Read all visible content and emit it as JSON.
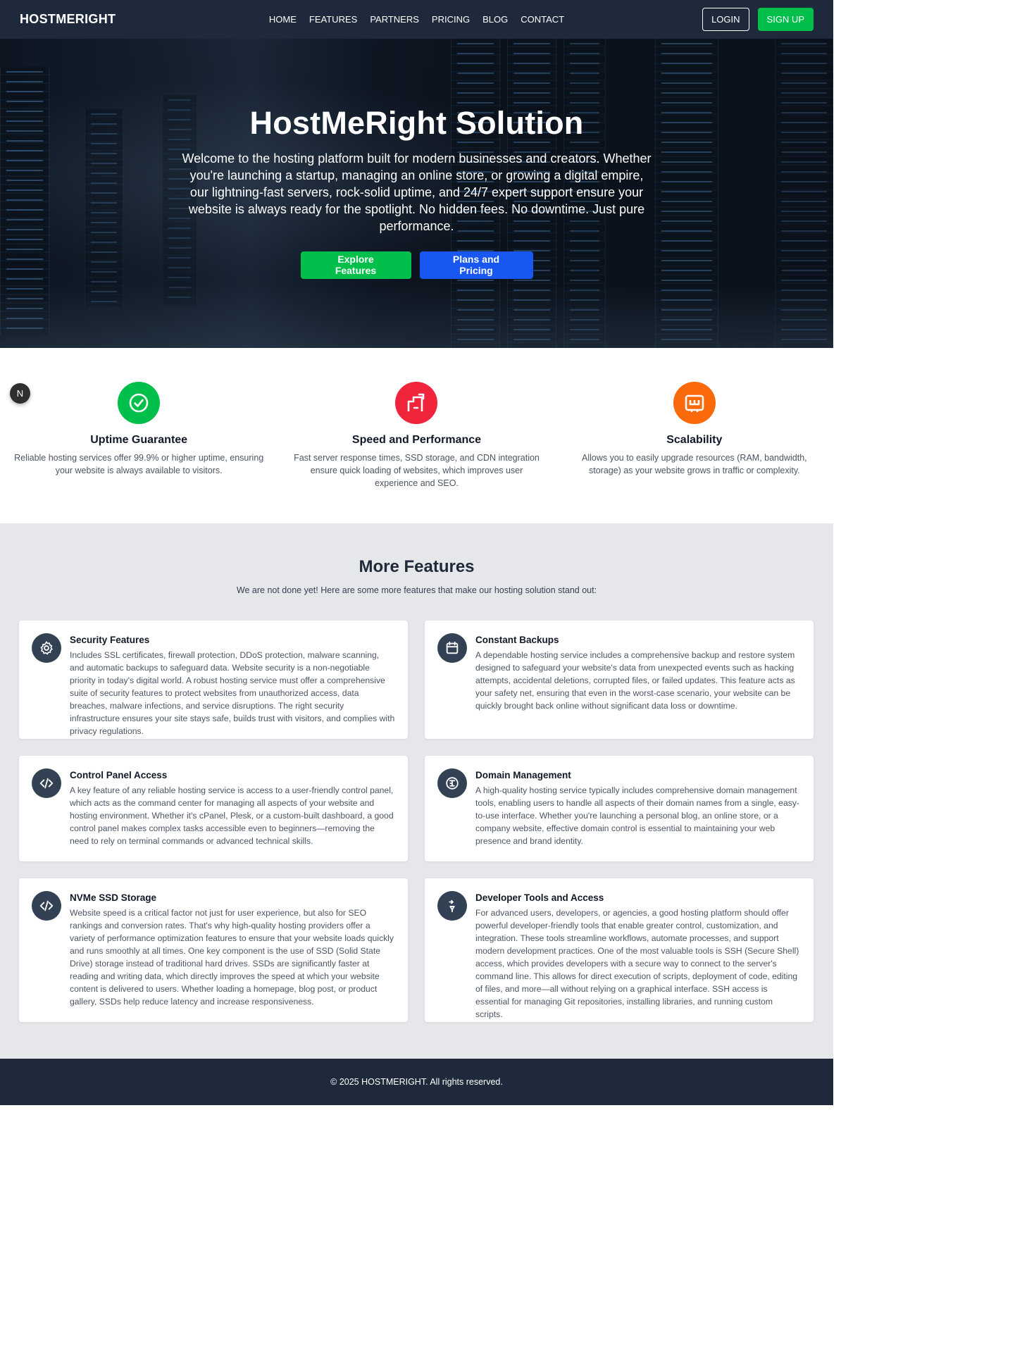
{
  "navbar": {
    "brand": "HOSTMERIGHT",
    "links": [
      "HOME",
      "FEATURES",
      "PARTNERS",
      "PRICING",
      "BLOG",
      "CONTACT"
    ],
    "login_label": "LOGIN",
    "signup_label": "SIGN UP"
  },
  "hero": {
    "title": "HostMeRight Solution",
    "text": "Welcome to the hosting platform built for modern businesses and creators. Whether you're launching a startup, managing an online store, or growing a digital empire, our lightning-fast servers, rock-solid uptime, and 24/7 expert support ensure your website is always ready for the spotlight. No hidden fees. No downtime. Just pure performance.",
    "explore_label": "Explore Features",
    "plans_label": "Plans and Pricing"
  },
  "floating_badge": "N",
  "highlights": [
    {
      "title": "Uptime Guarantee",
      "desc": "Reliable hosting services offer 99.9% or higher uptime, ensuring your website is always available to visitors.",
      "icon": "check-circle-icon",
      "color": "#00c04b"
    },
    {
      "title": "Speed and Performance",
      "desc": "Fast server response times, SSD storage, and CDN integration ensure quick loading of websites, which improves user experience and SEO.",
      "icon": "speed-icon",
      "color": "#f0243a"
    },
    {
      "title": "Scalability",
      "desc": "Allows you to easily upgrade resources (RAM, bandwidth, storage) as your website grows in traffic or complexity.",
      "icon": "scale-icon",
      "color": "#fa6a0a"
    }
  ],
  "more_features": {
    "title": "More Features",
    "subtitle": "We are not done yet! Here are some more features that make our hosting solution stand out:",
    "cards": [
      {
        "title": "Security Features",
        "icon": "gear-icon",
        "desc": "Includes SSL certificates, firewall protection, DDoS protection, malware scanning, and automatic backups to safeguard data. Website security is a non-negotiable priority in today's digital world. A robust hosting service must offer a comprehensive suite of security features to protect websites from unauthorized access, data breaches, malware infections, and service disruptions. The right security infrastructure ensures your site stays safe, builds trust with visitors, and complies with privacy regulations."
      },
      {
        "title": "Constant Backups",
        "icon": "calendar-icon",
        "desc": "A dependable hosting service includes a comprehensive backup and restore system designed to safeguard your website's data from unexpected events such as hacking attempts, accidental deletions, corrupted files, or failed updates. This feature acts as your safety net, ensuring that even in the worst-case scenario, your website can be quickly brought back online without significant data loss or downtime."
      },
      {
        "title": "Control Panel Access",
        "icon": "code-icon",
        "desc": "A key feature of any reliable hosting service is access to a user-friendly control panel, which acts as the command center for managing all aspects of your website and hosting environment. Whether it's cPanel, Plesk, or a custom-built dashboard, a good control panel makes complex tasks accessible even to beginners—removing the need to rely on terminal commands or advanced technical skills."
      },
      {
        "title": "Domain Management",
        "icon": "domain-icon",
        "desc": "A high-quality hosting service typically includes comprehensive domain management tools, enabling users to handle all aspects of their domain names from a single, easy-to-use interface. Whether you're launching a personal blog, an online store, or a company website, effective domain control is essential to maintaining your web presence and brand identity."
      },
      {
        "title": "NVMe SSD Storage",
        "icon": "code-icon",
        "desc": "Website speed is a critical factor not just for user experience, but also for SEO rankings and conversion rates. That's why high-quality hosting providers offer a variety of performance optimization features to ensure that your website loads quickly and runs smoothly at all times. One key component is the use of SSD (Solid State Drive) storage instead of traditional hard drives. SSDs are significantly faster at reading and writing data, which directly improves the speed at which your website content is delivered to users. Whether loading a homepage, blog post, or product gallery, SSDs help reduce latency and increase responsiveness."
      },
      {
        "title": "Developer Tools and Access",
        "icon": "tools-icon",
        "desc": "For advanced users, developers, or agencies, a good hosting platform should offer powerful developer-friendly tools that enable greater control, customization, and integration. These tools streamline workflows, automate processes, and support modern development practices. One of the most valuable tools is SSH (Secure Shell) access, which provides developers with a secure way to connect to the server's command line. This allows for direct execution of scripts, deployment of code, editing of files, and more—all without relying on a graphical interface. SSH access is essential for managing Git repositories, installing libraries, and running custom scripts."
      }
    ]
  },
  "footer": {
    "text": "© 2025 HOSTMERIGHT. All rights reserved."
  }
}
